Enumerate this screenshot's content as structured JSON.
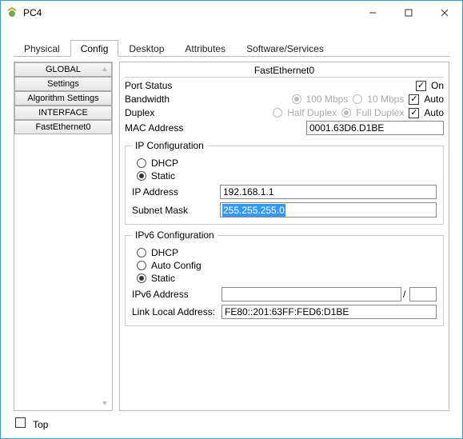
{
  "window": {
    "title": "PC4"
  },
  "tabs": {
    "items": [
      {
        "label": "Physical",
        "active": false
      },
      {
        "label": "Config",
        "active": true
      },
      {
        "label": "Desktop",
        "active": false
      },
      {
        "label": "Attributes",
        "active": false
      },
      {
        "label": "Software/Services",
        "active": false
      }
    ]
  },
  "sidebar": {
    "global_label": "GLOBAL",
    "settings_label": "Settings",
    "algorithm_label": "Algorithm Settings",
    "interface_label": "INTERFACE",
    "fastethernet_label": "FastEthernet0"
  },
  "panel": {
    "title": "FastEthernet0",
    "port_status_label": "Port Status",
    "on_label": "On",
    "bandwidth_label": "Bandwidth",
    "bw_100": "100 Mbps",
    "bw_10": "10 Mbps",
    "auto_label": "Auto",
    "duplex_label": "Duplex",
    "half_duplex": "Half Duplex",
    "full_duplex": "Full Duplex",
    "mac_label": "MAC Address",
    "mac_value": "0001.63D6.D1BE",
    "ip_conf_legend": "IP Configuration",
    "dhcp_label": "DHCP",
    "static_label": "Static",
    "ip_label": "IP Address",
    "ip_value": "192.168.1.1",
    "subnet_label": "Subnet Mask",
    "subnet_value": "255.255.255.0",
    "ipv6_conf_legend": "IPv6 Configuration",
    "auto_config_label": "Auto Config",
    "ipv6_addr_label": "IPv6 Address",
    "ipv6_addr_value": "",
    "ipv6_prefix_value": "",
    "link_local_label": "Link Local Address:",
    "link_local_value": "FE80::201:63FF:FED6:D1BE"
  },
  "footer": {
    "top_label": "Top"
  }
}
